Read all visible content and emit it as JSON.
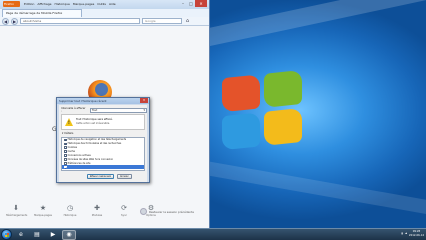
{
  "browser": {
    "app_button": "Firefox",
    "menu": [
      "Edition",
      "Affichage",
      "Historique",
      "Marque-pages",
      "Outils",
      "Aide"
    ],
    "tab_title": "Page de démarrage de Mozilla Firefox",
    "url": "about:home",
    "search_engine": "Google",
    "content": {
      "search_brand": "Go",
      "bottom_items": [
        {
          "icon": "download-icon",
          "label": "Téléchargements"
        },
        {
          "icon": "bookmark-icon",
          "label": "Marque-pages"
        },
        {
          "icon": "history-icon",
          "label": "Historique"
        },
        {
          "icon": "addons-icon",
          "label": "Modules"
        },
        {
          "icon": "sync-icon",
          "label": "Sync"
        },
        {
          "icon": "settings-icon",
          "label": "Options"
        }
      ],
      "restore_label": "Restaurer la session précédente"
    }
  },
  "dialog": {
    "title": "Supprimer tout l'historique récent",
    "range_label": "Intervalle à effacer :",
    "range_value": "Tout",
    "warning_title": "Tout l'historique sera effacé.",
    "warning_subtitle": "Cette action est irréversible.",
    "details_label": "Détails",
    "items": [
      {
        "label": "Historique de navigation et des téléchargements",
        "checked": true,
        "selected": false
      },
      {
        "label": "Historique des formulaires et des recherches",
        "checked": true,
        "selected": false
      },
      {
        "label": "Cookies",
        "checked": true,
        "selected": false
      },
      {
        "label": "Cache",
        "checked": true,
        "selected": false
      },
      {
        "label": "Connexions actives",
        "checked": true,
        "selected": false
      },
      {
        "label": "Données de sites Web hors connexion",
        "checked": false,
        "selected": false
      },
      {
        "label": "Préférences de site",
        "checked": false,
        "selected": false
      },
      {
        "label": "",
        "checked": true,
        "selected": true
      }
    ],
    "ok_label": "Effacer maintenant",
    "cancel_label": "Annuler"
  },
  "taskbar": {
    "apps": [
      "ie-icon",
      "explorer-icon",
      "media-icon",
      "firefox-icon"
    ],
    "clock_time": "09:28",
    "clock_date": "2012-06-14"
  },
  "colors": {
    "accent": "#3b78d6",
    "firefox_orange": "#e66a15",
    "desktop_blue": "#2a7fc6"
  }
}
